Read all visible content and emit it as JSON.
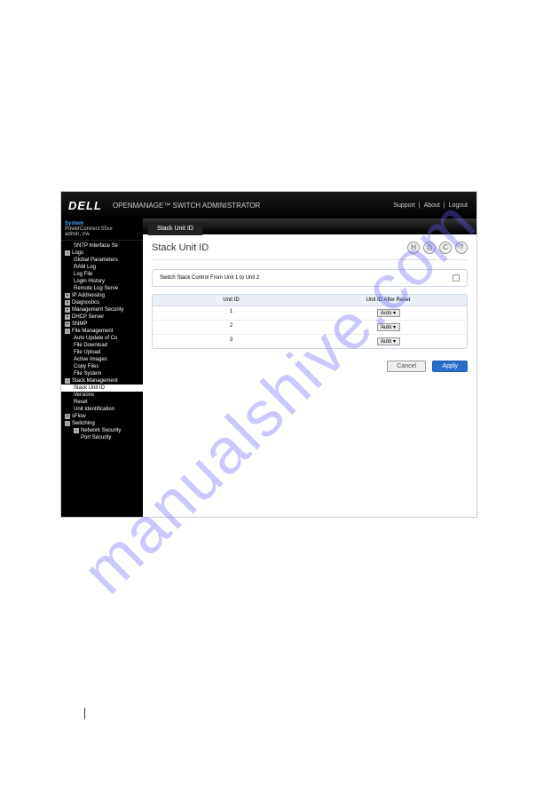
{
  "watermark": "manualshive.com",
  "topbar": {
    "logo": "DELL",
    "title": "OPENMANAGE™ SWITCH ADMINISTRATOR",
    "links": [
      "Support",
      "About",
      "Logout"
    ]
  },
  "sidebar": {
    "system": "System",
    "device": "PowerConnect 55xx",
    "user": "admin, r/w",
    "tree": [
      {
        "l": 2,
        "t": "SNTP Interface Se"
      },
      {
        "l": 1,
        "t": "Logs",
        "exp": "-"
      },
      {
        "l": 2,
        "t": "Global Parameters"
      },
      {
        "l": 2,
        "t": "RAM Log"
      },
      {
        "l": 2,
        "t": "Log File"
      },
      {
        "l": 2,
        "t": "Login History"
      },
      {
        "l": 2,
        "t": "Remote Log Serve"
      },
      {
        "l": 1,
        "t": "IP Addressing",
        "exp": "+"
      },
      {
        "l": 1,
        "t": "Diagnostics",
        "exp": "+"
      },
      {
        "l": 1,
        "t": "Management Security",
        "exp": "+"
      },
      {
        "l": 1,
        "t": "DHCP Server",
        "exp": "+"
      },
      {
        "l": 1,
        "t": "SNMP",
        "exp": "+"
      },
      {
        "l": 1,
        "t": "File Management",
        "exp": "-"
      },
      {
        "l": 2,
        "t": "Auto Update of Co"
      },
      {
        "l": 2,
        "t": "File Download"
      },
      {
        "l": 2,
        "t": "File Upload"
      },
      {
        "l": 2,
        "t": "Active Images"
      },
      {
        "l": 2,
        "t": "Copy Files"
      },
      {
        "l": 2,
        "t": "File System"
      },
      {
        "l": 1,
        "t": "Stack Management",
        "exp": "-"
      },
      {
        "l": 2,
        "t": "Stack Unit ID",
        "sel": true
      },
      {
        "l": 2,
        "t": "Versions"
      },
      {
        "l": 2,
        "t": "Reset"
      },
      {
        "l": 2,
        "t": "Unit Identification"
      },
      {
        "l": 1,
        "t": "sFlow",
        "exp": "+"
      },
      {
        "l": 1,
        "t": "Switching",
        "exp": "-"
      },
      {
        "l": 2,
        "t": "Network Security",
        "exp": "-"
      },
      {
        "l": 3,
        "t": "Port Security"
      }
    ]
  },
  "content": {
    "tab": "Stack Unit ID",
    "title": "Stack Unit ID",
    "switchLabel": "Switch Stack Control From Unit 1 to Unit 2",
    "th1": "Unit ID",
    "th2": "Unit ID After Reset",
    "rows": [
      {
        "id": "1",
        "val": "Auto"
      },
      {
        "id": "2",
        "val": "Auto"
      },
      {
        "id": "3",
        "val": "Auto"
      }
    ],
    "cancel": "Cancel",
    "apply": "Apply"
  }
}
